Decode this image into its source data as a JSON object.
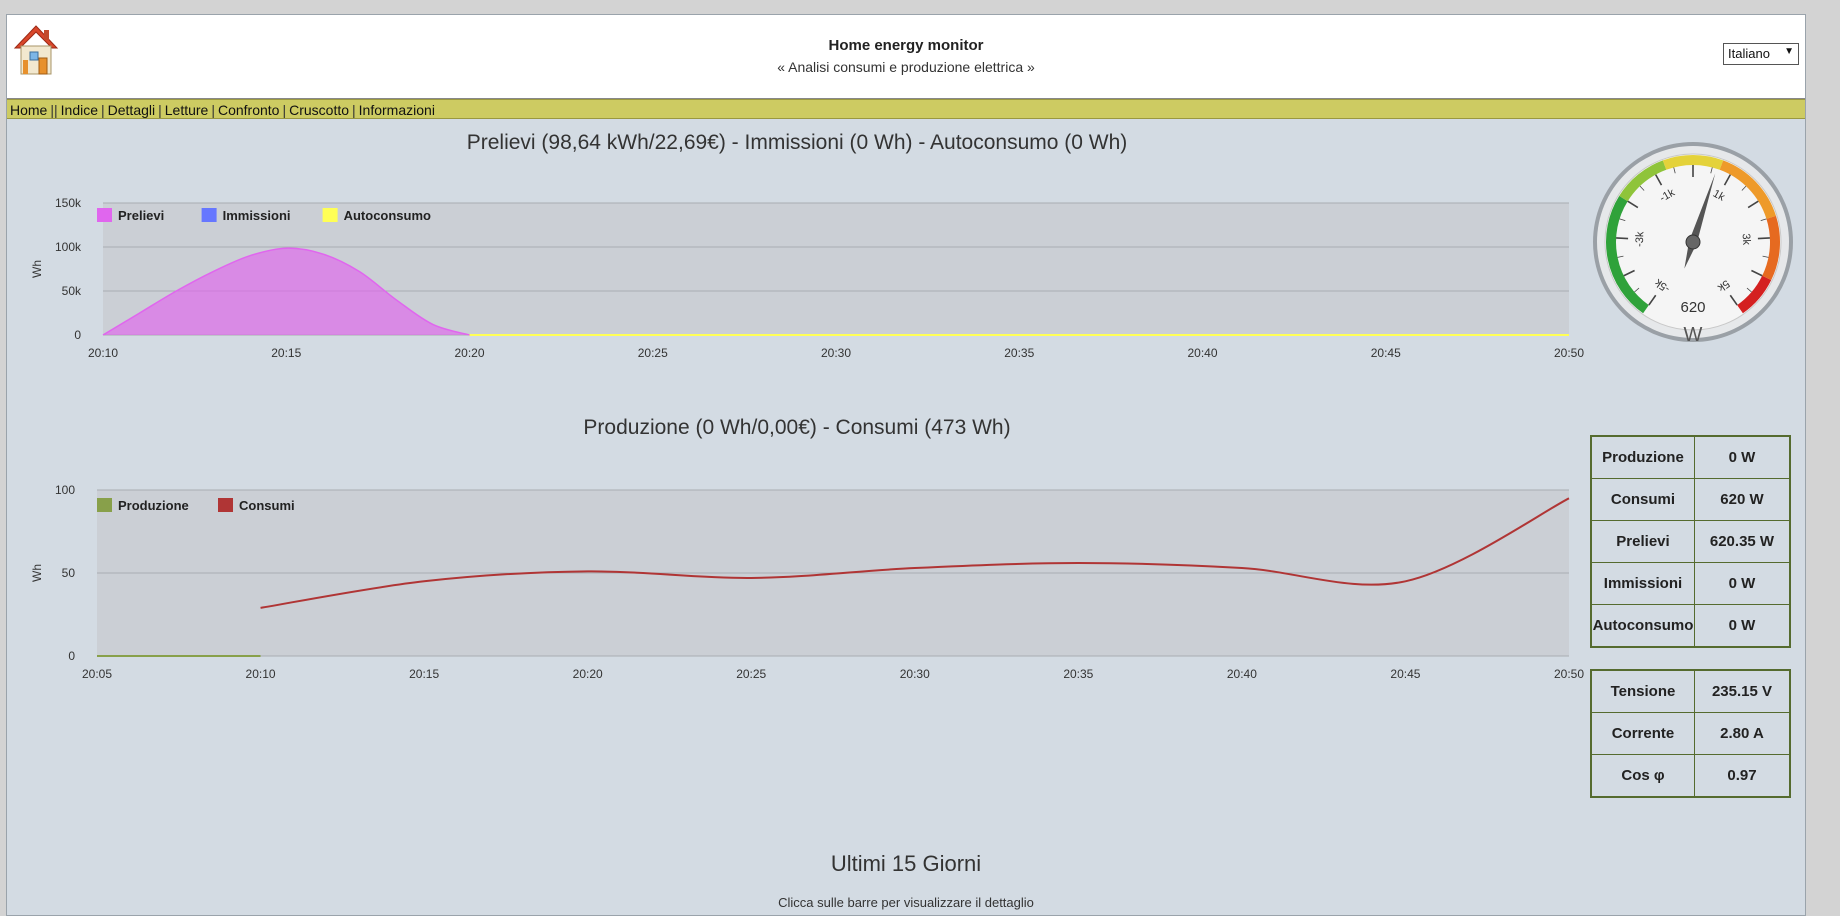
{
  "header": {
    "title": "Home energy monitor",
    "subtitle": "« Analisi consumi e produzione elettrica »",
    "language": "Italiano"
  },
  "nav": {
    "items": [
      "Home",
      "Indice",
      "Dettagli",
      "Letture",
      "Confronto",
      "Cruscotto",
      "Informazioni"
    ]
  },
  "chart1": {
    "title": "Prelievi (98,64 kWh/22,69€) - Immissioni (0 Wh) - Autoconsumo (0 Wh)"
  },
  "chart2": {
    "title": "Produzione (0 Wh/0,00€) - Consumi (473 Wh)"
  },
  "gauge": {
    "value": 620,
    "value_label": "620",
    "unit": "W",
    "min": -5000,
    "max": 5000,
    "tick_labels": [
      "-5k",
      "-3k",
      "-1k",
      "1k",
      "3k",
      "5k"
    ],
    "tick_values": [
      -5000,
      -3000,
      -1000,
      1000,
      3000,
      5000
    ]
  },
  "table_power": {
    "rows": [
      {
        "label": "Produzione",
        "value": "0 W"
      },
      {
        "label": "Consumi",
        "value": "620 W"
      },
      {
        "label": "Prelievi",
        "value": "620.35 W"
      },
      {
        "label": "Immissioni",
        "value": "0 W"
      },
      {
        "label": "Autoconsumo",
        "value": "0 W"
      }
    ]
  },
  "table_electrical": {
    "rows": [
      {
        "label": "Tensione",
        "value": "235.15 V"
      },
      {
        "label": "Corrente",
        "value": "2.80 A"
      },
      {
        "label": "Cos φ",
        "value": "0.97"
      }
    ]
  },
  "bottom": {
    "title": "Ultimi 15 Giorni",
    "hint": "Clicca sulle barre per visualizzare il dettaglio"
  },
  "colors": {
    "prelievi": "#e066ee",
    "immissioni": "#6677ff",
    "autoconsumo": "#ffff55",
    "produzione": "#88a04a",
    "consumi": "#b03535",
    "navbar": "#cdcb62"
  },
  "chart_data": [
    {
      "type": "area",
      "title": "Prelievi (98,64 kWh/22,69€) - Immissioni (0 Wh) - Autoconsumo (0 Wh)",
      "ylabel": "Wh",
      "ylim": [
        0,
        150000
      ],
      "yticks": [
        0,
        50000,
        100000,
        150000
      ],
      "ytick_labels": [
        "0",
        "50k",
        "100k",
        "150k"
      ],
      "xticks": [
        "20:10",
        "20:15",
        "20:20",
        "20:25",
        "20:30",
        "20:35",
        "20:40",
        "20:45",
        "20:50"
      ],
      "xrange": [
        "20:10",
        "20:50"
      ],
      "legend": "top-left",
      "grid": true,
      "series": [
        {
          "name": "Prelievi",
          "x": [
            "20:10",
            "20:11",
            "20:12",
            "20:13",
            "20:14",
            "20:15",
            "20:16",
            "20:17",
            "20:18",
            "20:19",
            "20:20"
          ],
          "values": [
            0,
            25000,
            50000,
            72000,
            90000,
            98640,
            92000,
            72000,
            40000,
            12000,
            0
          ]
        },
        {
          "name": "Immissioni",
          "x": [
            "20:20",
            "20:50"
          ],
          "values": [
            0,
            0
          ]
        },
        {
          "name": "Autoconsumo",
          "x": [
            "20:20",
            "20:50"
          ],
          "values": [
            0,
            0
          ]
        }
      ]
    },
    {
      "type": "line",
      "title": "Produzione (0 Wh/0,00€) - Consumi (473 Wh)",
      "ylabel": "Wh",
      "ylim": [
        0,
        100
      ],
      "yticks": [
        0,
        50,
        100
      ],
      "ytick_labels": [
        "0",
        "50",
        "100"
      ],
      "xticks": [
        "20:05",
        "20:10",
        "20:15",
        "20:20",
        "20:25",
        "20:30",
        "20:35",
        "20:40",
        "20:45",
        "20:50"
      ],
      "xrange": [
        "20:05",
        "20:50"
      ],
      "legend": "top-left",
      "grid": true,
      "series": [
        {
          "name": "Produzione",
          "x": [
            "20:05",
            "20:10"
          ],
          "values": [
            0,
            0
          ]
        },
        {
          "name": "Consumi",
          "x": [
            "20:10",
            "20:15",
            "20:20",
            "20:25",
            "20:30",
            "20:35",
            "20:40",
            "20:45",
            "20:50"
          ],
          "values": [
            29,
            45,
            51,
            47,
            53,
            56,
            53,
            45,
            95
          ]
        }
      ]
    }
  ]
}
